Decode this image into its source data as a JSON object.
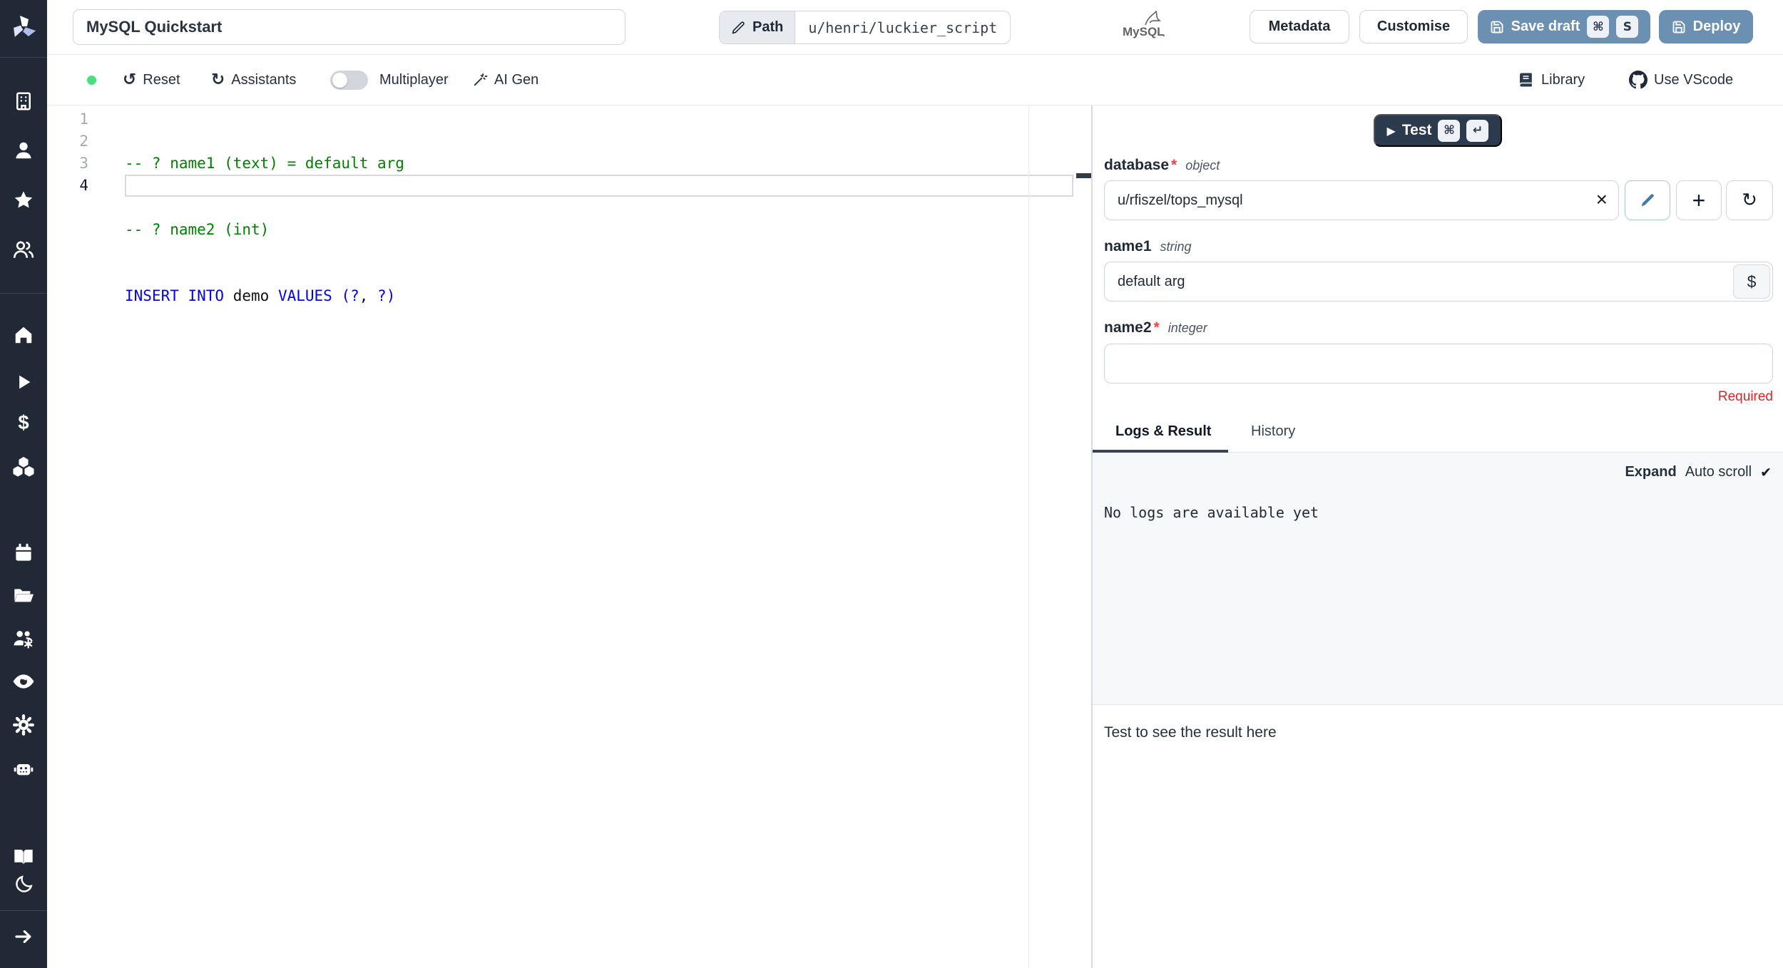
{
  "topbar": {
    "title_value": "MySQL Quickstart",
    "path_label": "Path",
    "path_value": "u/henri/luckier_script",
    "language_logo_text": "MySQL",
    "metadata_label": "Metadata",
    "customise_label": "Customise",
    "save_draft_label": "Save draft",
    "deploy_label": "Deploy",
    "kbd_cmd": "⌘",
    "kbd_s": "S"
  },
  "toolbar": {
    "reset_icon": "↺",
    "reset_label": "Reset",
    "assistants_icon": "↻",
    "assistants_label": "Assistants",
    "multiplayer_label": "Multiplayer",
    "ai_gen_label": "AI Gen",
    "library_label": "Library",
    "vscode_label": "Use VScode"
  },
  "editor": {
    "line_numbers": [
      "1",
      "2",
      "3",
      "4"
    ],
    "line1_comment": "-- ? name1 (text) = default arg",
    "line2_comment": "-- ? name2 (int)",
    "line3": {
      "kw1": "INSERT INTO",
      "plain1": " demo ",
      "kw2": "VALUES",
      "plain2": " ",
      "kw3": "(?",
      "plain3": ", ",
      "kw4": "?)"
    }
  },
  "runner": {
    "test_label": "Test",
    "play_icon": "▶",
    "kbd_cmd": "⌘",
    "kbd_enter": "↵"
  },
  "form": {
    "database": {
      "name": "database",
      "required_mark": "*",
      "type": "object",
      "value": "u/rfiszel/tops_mysql",
      "clear_icon": "×",
      "plus_icon": "+",
      "refresh_icon": "↻"
    },
    "name1": {
      "name": "name1",
      "type": "string",
      "value": "default arg",
      "var_button": "$"
    },
    "name2": {
      "name": "name2",
      "required_mark": "*",
      "type": "integer",
      "value": "",
      "error": "Required"
    }
  },
  "tabs": {
    "logs_result": "Logs & Result",
    "history": "History"
  },
  "logs": {
    "expand_label": "Expand",
    "autoscroll_label": "Auto scroll",
    "check_icon": "✔",
    "empty_text": "No logs are available yet"
  },
  "result": {
    "placeholder": "Test to see the result here"
  },
  "colors": {
    "primary_button_blue": "#6c90b2",
    "dark_button_navy": "#2c3a4e",
    "sidebar_navy": "#222936",
    "status_green": "#4ade80",
    "keyword_blue": "#0000ff",
    "comment_green": "#008000",
    "error_red": "#dc2626"
  }
}
